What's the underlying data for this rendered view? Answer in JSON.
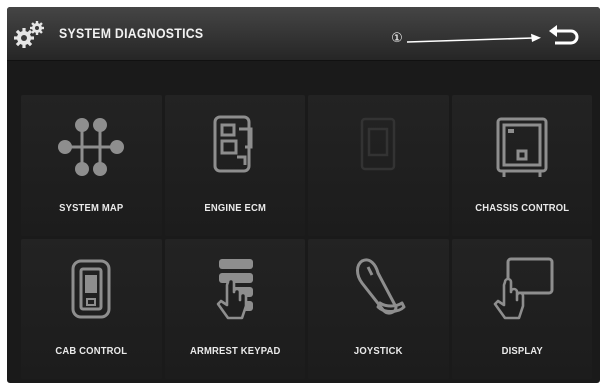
{
  "header": {
    "title": "SYSTEM DIAGNOSTICS",
    "callout_number": "①",
    "icons": {
      "settings": "gears-icon",
      "back": "return-arrow-icon"
    }
  },
  "tiles": [
    {
      "label": "SYSTEM MAP",
      "icon": "system-map-icon",
      "enabled": true
    },
    {
      "label": "ENGINE ECM",
      "icon": "engine-ecm-icon",
      "enabled": true
    },
    {
      "label": "",
      "icon": "module-icon",
      "enabled": false
    },
    {
      "label": "CHASSIS CONTROL",
      "icon": "chassis-control-icon",
      "enabled": true
    },
    {
      "label": "CAB CONTROL",
      "icon": "cab-control-icon",
      "enabled": true
    },
    {
      "label": "ARMREST KEYPAD",
      "icon": "armrest-keypad-icon",
      "enabled": true
    },
    {
      "label": "JOYSTICK",
      "icon": "joystick-icon",
      "enabled": true
    },
    {
      "label": "DISPLAY",
      "icon": "display-touch-icon",
      "enabled": true
    }
  ],
  "colors": {
    "background": "#1a1a1a",
    "tile": "#1f1f1f",
    "icon": "#9a9a9a",
    "text": "#eaeaea"
  }
}
